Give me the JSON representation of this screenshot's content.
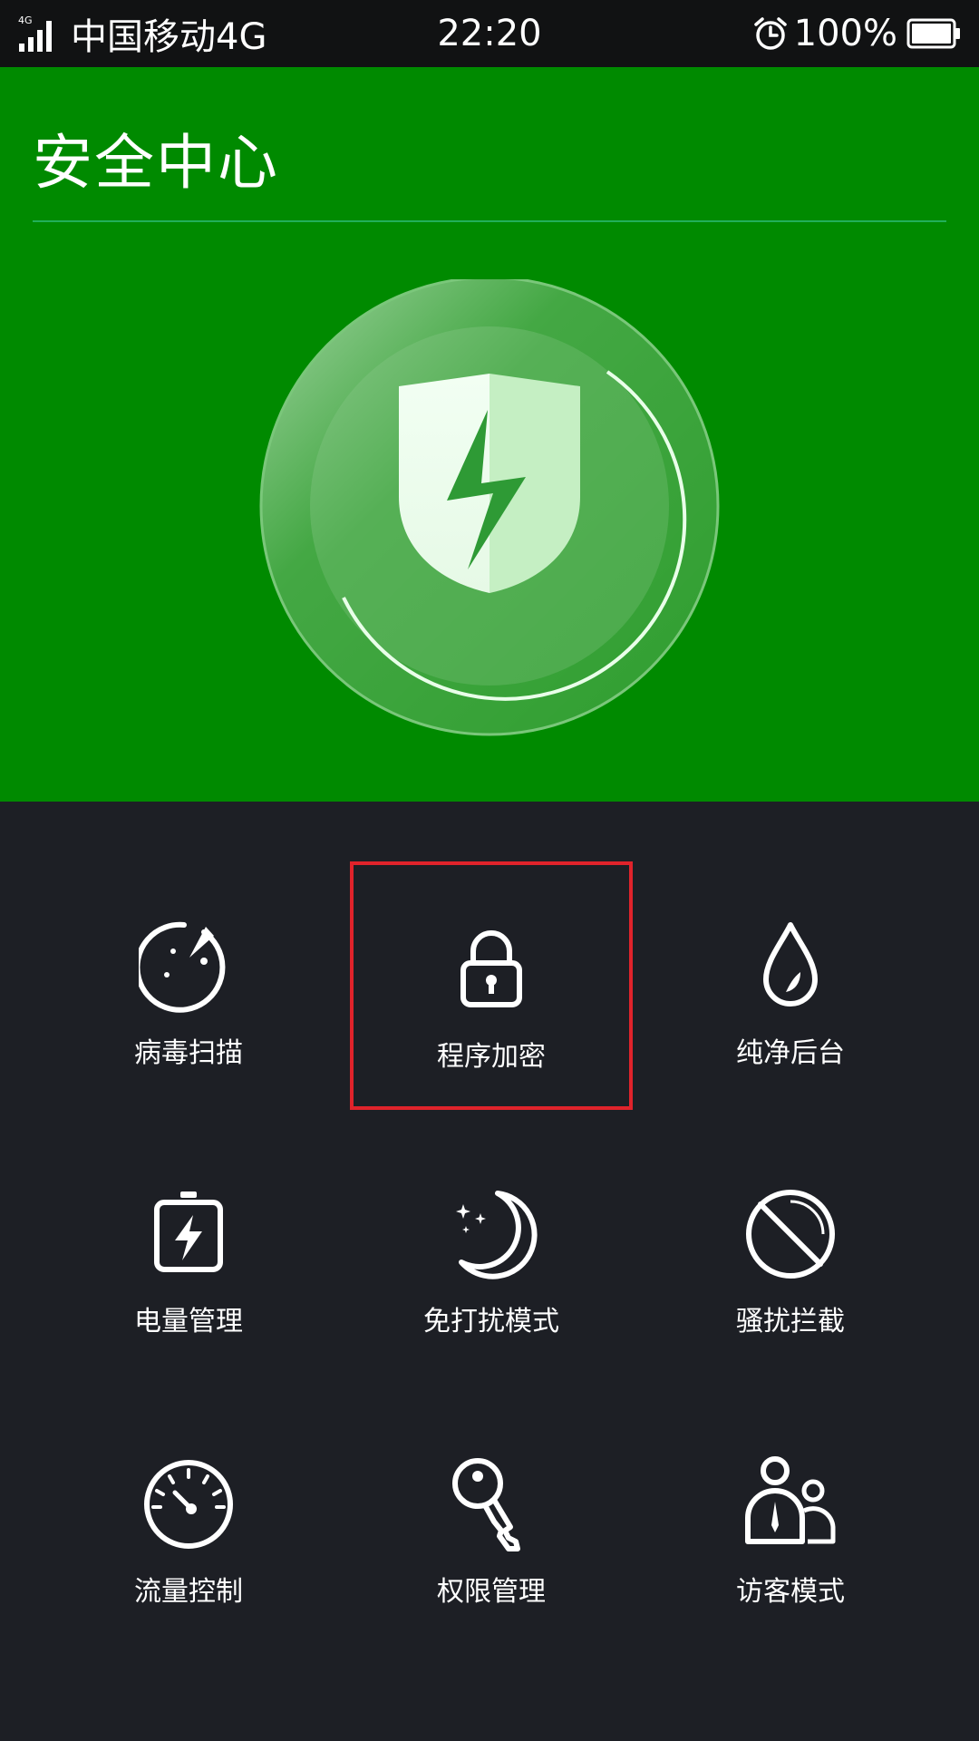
{
  "status_bar": {
    "network_type": "4G",
    "carrier": "中国移动4G",
    "time": "22:20",
    "battery": "100%"
  },
  "header": {
    "title": "安全中心"
  },
  "colors": {
    "hero_green": "#008a00",
    "grid_bg": "#1d1f25",
    "selection_red": "#e0232b"
  },
  "features": [
    {
      "label": "病毒扫描",
      "icon": "radar-scan-icon"
    },
    {
      "label": "程序加密",
      "icon": "lock-icon",
      "selected": true
    },
    {
      "label": "纯净后台",
      "icon": "water-drop-icon"
    },
    {
      "label": "电量管理",
      "icon": "battery-bolt-icon"
    },
    {
      "label": "免打扰模式",
      "icon": "moon-stars-icon"
    },
    {
      "label": "骚扰拦截",
      "icon": "block-icon"
    },
    {
      "label": "流量控制",
      "icon": "speedometer-icon"
    },
    {
      "label": "权限管理",
      "icon": "key-icon"
    },
    {
      "label": "访客模式",
      "icon": "guest-users-icon"
    }
  ]
}
